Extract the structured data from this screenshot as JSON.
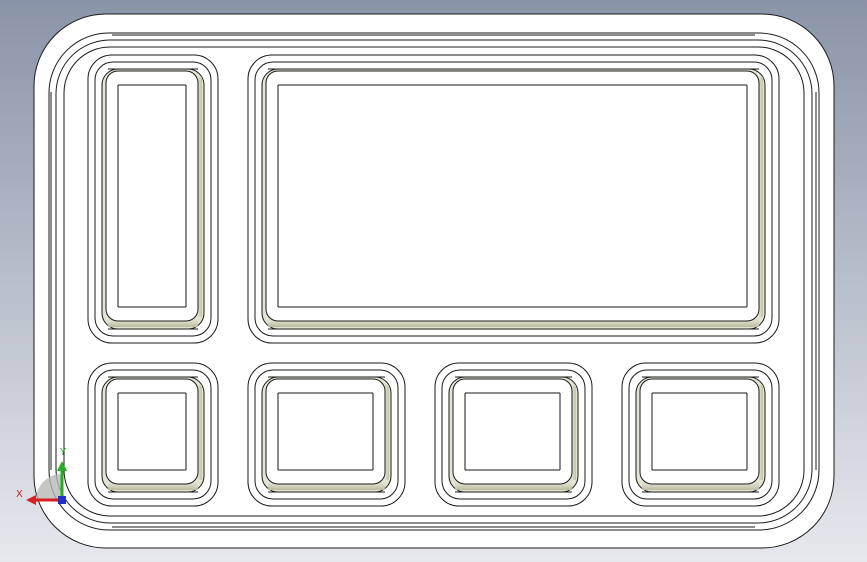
{
  "viewport": {
    "background_top": "#8a94a8",
    "background_bottom": "#e6e8ed",
    "part_fill": "#ffffff",
    "edge_color": "#1a1a1a",
    "fillet_shade": "#c9c9a8"
  },
  "triad": {
    "x_label": "X",
    "y_label": "Y",
    "x_color": "#d42020",
    "y_color": "#22b022",
    "z_color": "#2030c8"
  }
}
